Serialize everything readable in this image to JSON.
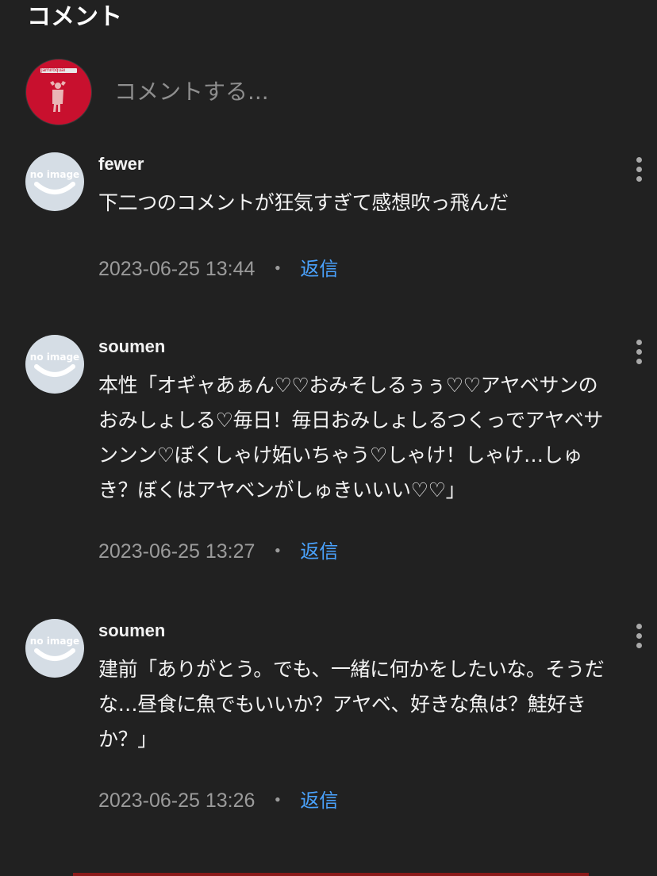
{
  "section": {
    "title": "コメント"
  },
  "compose": {
    "placeholder": "コメントする...",
    "avatar_text": "Jamiroquai"
  },
  "avatar_placeholder_text": "no image",
  "reply_label": "返信",
  "separator": "・",
  "comments": [
    {
      "username": "fewer",
      "text": "下二つのコメントが狂気すぎて感想吹っ飛んだ",
      "timestamp": "2023-06-25 13:44"
    },
    {
      "username": "soumen",
      "text": "本性「オギャあぁん♡♡おみそしるぅぅ♡♡アヤベサンのおみしょしる♡毎日！毎日おみしょしるつくっでアヤベサンンン♡ぼくしゃけ妬いちゃう♡しゃけ！しゃけ…しゅき？ぼくはアヤベンがしゅきいいい♡♡」",
      "timestamp": "2023-06-25 13:27"
    },
    {
      "username": "soumen",
      "text": "建前「ありがとう。でも、一緒に何かをしたいな。そうだな…昼食に魚でもいいか？アヤベ、好きな魚は？鮭好きか？」",
      "timestamp": "2023-06-25 13:26"
    }
  ],
  "colors": {
    "background": "#212121",
    "text": "#f2f2f2",
    "meta": "#9b9b9b",
    "link": "#4aa3ff",
    "avatar_bg": "#d5dde5",
    "my_avatar_bg": "#c8102e"
  }
}
